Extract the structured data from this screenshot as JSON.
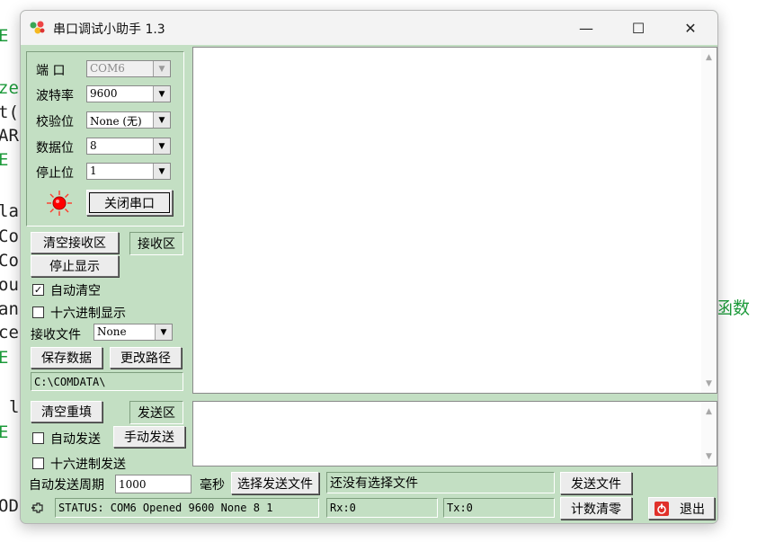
{
  "background": {
    "code_fragments": [
      {
        "text": "E",
        "green": true
      },
      {
        "text": "ze",
        "green": true
      },
      {
        "text": "t(",
        "green": false
      },
      {
        "text": "AR",
        "green": false
      },
      {
        "text": "E",
        "green": true
      },
      {
        "text": "la",
        "green": false
      },
      {
        "text": "Co",
        "green": false
      },
      {
        "text": "Co",
        "green": false
      },
      {
        "text": "ou",
        "green": false
      },
      {
        "text": "an",
        "green": false
      },
      {
        "text": "ce",
        "green": false
      },
      {
        "text": "E",
        "green": true
      },
      {
        "text": "l",
        "green": false
      },
      {
        "text": "E",
        "green": true
      },
      {
        "text": "OD",
        "green": false
      }
    ],
    "right_text": "函数"
  },
  "window": {
    "title": "串口调试小助手 1.3",
    "controls": {
      "minimize": "—",
      "maximize": "☐",
      "close": "✕"
    }
  },
  "port_settings": {
    "port_label": "端  口",
    "port_value": "COM6",
    "baud_label": "波特率",
    "baud_value": "9600",
    "parity_label": "校验位",
    "parity_value": "None (无)",
    "databits_label": "数据位",
    "databits_value": "8",
    "stopbits_label": "停止位",
    "stopbits_value": "1",
    "toggle_port_label": "关闭串口"
  },
  "receive": {
    "clear_label": "清空接收区",
    "area_tag": "接收区",
    "stop_display_label": "停止显示",
    "auto_clear_label": "自动清空",
    "auto_clear_checked": true,
    "hex_display_label": "十六进制显示",
    "hex_display_checked": false,
    "file_label": "接收文件",
    "file_value": "None",
    "save_label": "保存数据",
    "change_path_label": "更改路径",
    "path_value": "C:\\COMDATA\\"
  },
  "send": {
    "clear_label": "清空重填",
    "area_tag": "发送区",
    "auto_send_label": "自动发送",
    "auto_send_checked": false,
    "manual_send_label": "手动发送",
    "hex_send_label": "十六进制发送",
    "hex_send_checked": false,
    "period_label": "自动发送周期",
    "period_value": "1000",
    "ms_label": "毫秒",
    "select_file_label": "选择发送文件",
    "file_status": "还没有选择文件",
    "send_file_label": "发送文件"
  },
  "status": {
    "text": "STATUS: COM6 Opened 9600 None  8 1",
    "rx": "Rx:0",
    "tx": "Tx:0",
    "reset_count_label": "计数清零",
    "exit_label": "退出"
  },
  "colors": {
    "panel": "#c3dfc3",
    "indicator": "#ff0000",
    "exit_icon": "#e0302a"
  }
}
